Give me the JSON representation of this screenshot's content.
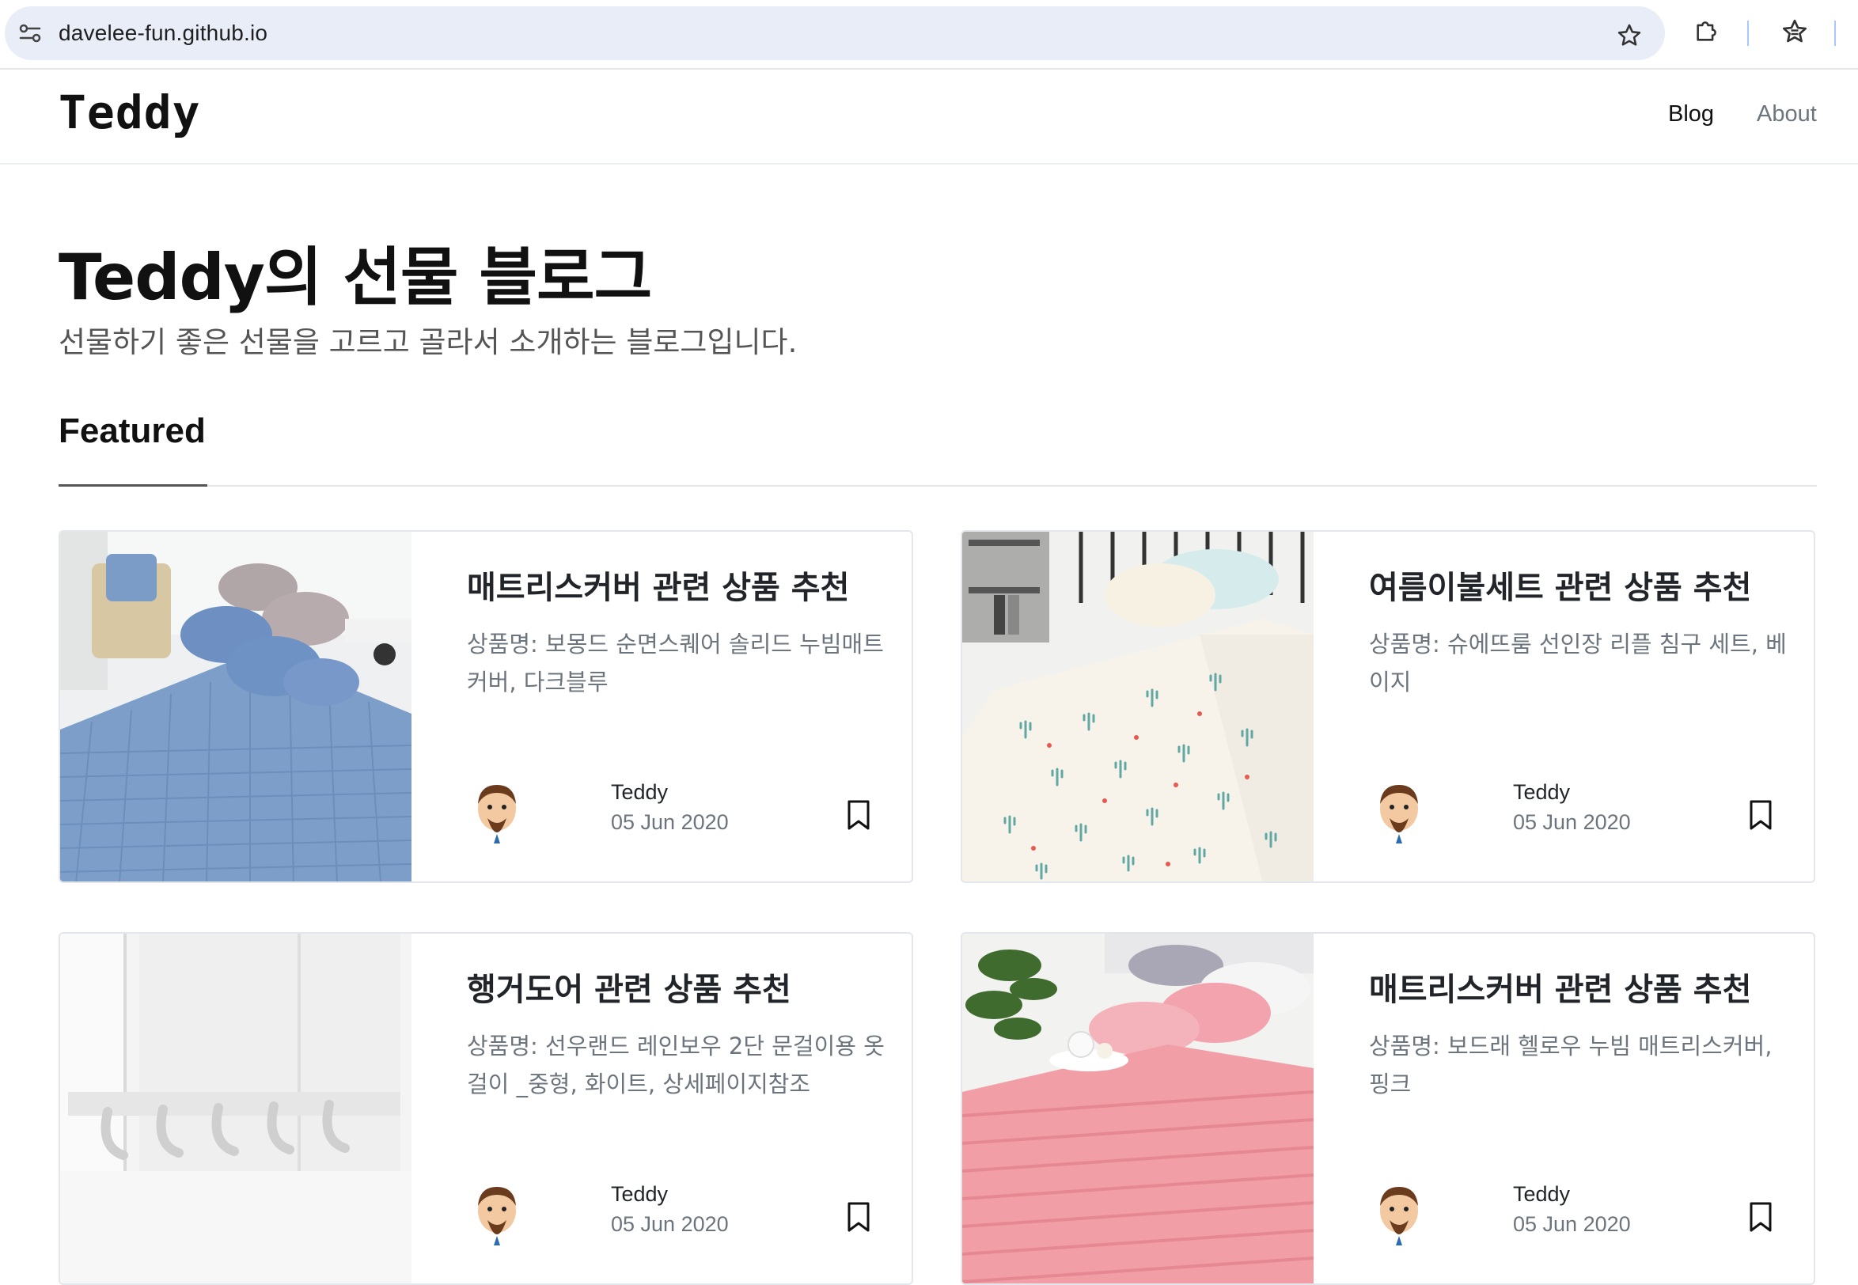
{
  "browser": {
    "url": "davelee-fun.github.io",
    "icons": [
      "site-info-icon",
      "bookmark-star-icon",
      "extensions-icon",
      "bookmarks-icon"
    ]
  },
  "header": {
    "logo": "Teddy",
    "nav": [
      {
        "label": "Blog",
        "active": true
      },
      {
        "label": "About",
        "active": false
      }
    ]
  },
  "hero": {
    "title": "Teddy의 선물 블로그",
    "subtitle": "선물하기 좋은 선물을 고르고 골라서 소개하는 블로그입니다."
  },
  "section": {
    "title": "Featured"
  },
  "cards": [
    {
      "title": "매트리스커버 관련 상품 추천",
      "excerpt": "상품명: 보몽드 순면스퀘어 솔리드 누빔매트커버, 다크블루",
      "author": "Teddy",
      "date": "05 Jun 2020",
      "image": "blue-quilted-mattress-cover-photo"
    },
    {
      "title": "여름이불세트 관련 상품 추천",
      "excerpt": "상품명: 슈에뜨룸 선인장 리플 침구 세트, 베이지",
      "author": "Teddy",
      "date": "05 Jun 2020",
      "image": "cactus-print-bedding-photo"
    },
    {
      "title": "행거도어 관련 상품 추천",
      "excerpt": "상품명: 선우랜드 레인보우 2단 문걸이용 옷걸이 _중형, 화이트, 상세페이지참조",
      "author": "Teddy",
      "date": "05 Jun 2020",
      "image": "white-door-hanger-photo"
    },
    {
      "title": "매트리스커버 관련 상품 추천",
      "excerpt": "상품명: 보드래 헬로우 누빔 매트리스커버, 핑크",
      "author": "Teddy",
      "date": "05 Jun 2020",
      "image": "pink-mattress-cover-photo"
    }
  ],
  "colors": {
    "text": "#212529",
    "muted": "#6c757d",
    "border": "#e3e6ea",
    "url_bar": "#e9edf7"
  }
}
